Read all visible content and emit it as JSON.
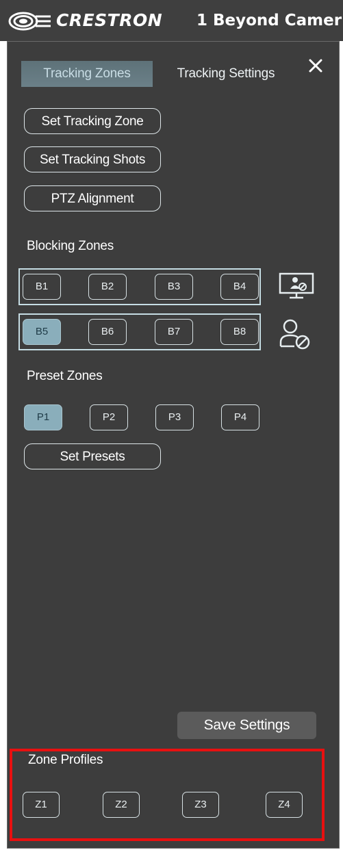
{
  "header": {
    "brand": "CRESTRON",
    "product": "1 Beyond Camer"
  },
  "tabs": [
    {
      "label": "Tracking Zones",
      "active": true
    },
    {
      "label": "Tracking Settings",
      "active": false
    }
  ],
  "actions": {
    "set_tracking_zone": "Set Tracking Zone",
    "set_tracking_shots": "Set Tracking Shots",
    "ptz_alignment": "PTZ Alignment",
    "set_presets": "Set Presets",
    "save_settings": "Save Settings"
  },
  "blocking_zones": {
    "label": "Blocking Zones",
    "rows": [
      [
        "B1",
        "B2",
        "B3",
        "B4"
      ],
      [
        "B5",
        "B6",
        "B7",
        "B8"
      ]
    ],
    "selected": "B5",
    "row_icons": [
      "presenter-screen-icon",
      "person-block-icon"
    ]
  },
  "preset_zones": {
    "label": "Preset Zones",
    "items": [
      "P1",
      "P2",
      "P3",
      "P4"
    ],
    "selected": "P1"
  },
  "zone_profiles": {
    "label": "Zone Profiles",
    "items": [
      "Z1",
      "Z2",
      "Z3",
      "Z4"
    ]
  },
  "colors": {
    "panel_bg": "#3d3d3d",
    "accent": "#8aaebb",
    "highlight": "#e81010"
  }
}
